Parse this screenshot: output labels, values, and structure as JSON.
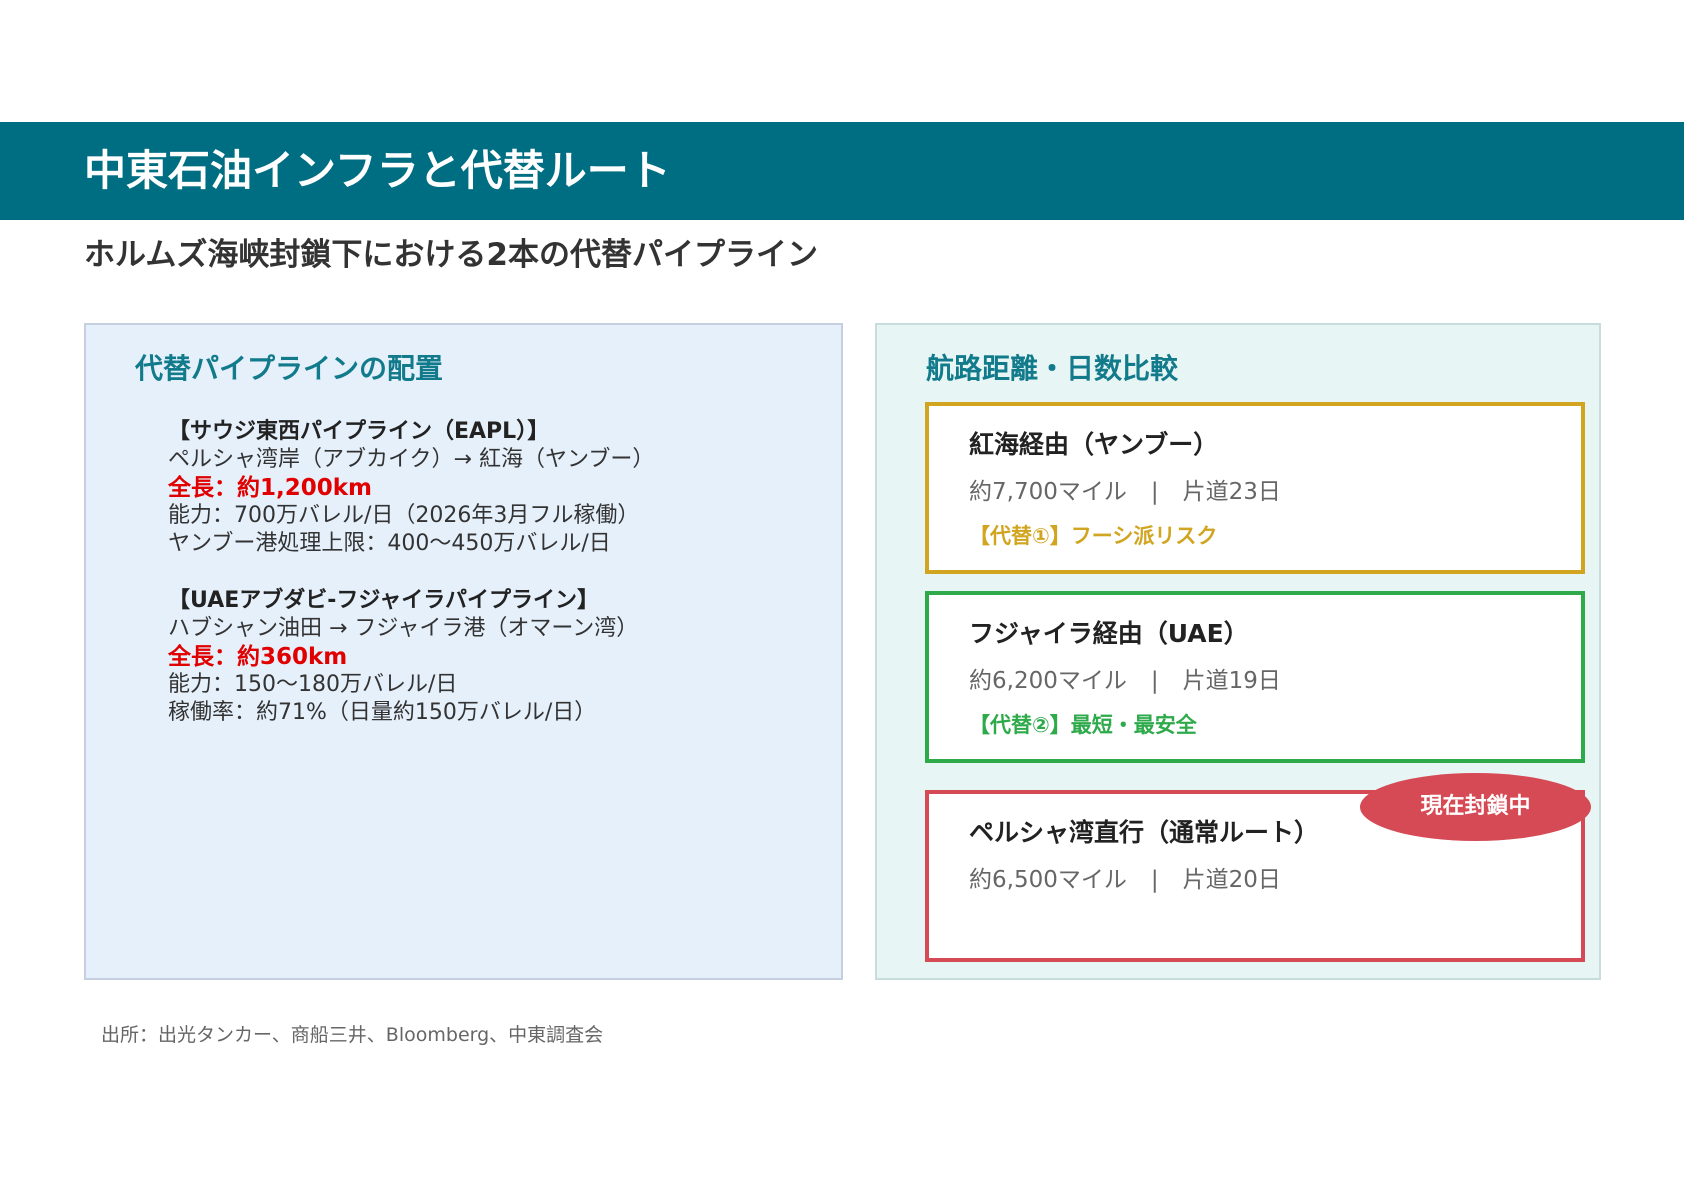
{
  "header": {
    "title": "中東石油インフラと代替ルート",
    "subtitle": "ホルムズ海峡封鎖下における2本の代替パイプライン"
  },
  "left_panel": {
    "heading": "代替パイプラインの配置",
    "pipelines": [
      {
        "name": "【サウジ東西パイプライン（EAPL）】",
        "route": "ペルシャ湾岸（アブカイク）→ 紅海（ヤンブー）",
        "length": "全長：約1,200km",
        "details": [
          "能力：700万バレル/日（2026年3月フル稼働）",
          "ヤンブー港処理上限：400〜450万バレル/日"
        ]
      },
      {
        "name": "【UAEアブダビ-フジャイラパイプライン】",
        "route": "ハブシャン油田 → フジャイラ港（オマーン湾）",
        "length": "全長：約360km",
        "details": [
          "能力：150〜180万バレル/日",
          "稼働率：約71%（日量約150万バレル/日）"
        ]
      }
    ]
  },
  "right_panel": {
    "heading": "航路距離・日数比較",
    "routes": [
      {
        "name": "紅海経由（ヤンブー）",
        "distance": "約7,700マイル",
        "separator": "|",
        "duration": "片道23日",
        "note": "【代替①】フーシ派リスク",
        "color": "#d1a520"
      },
      {
        "name": "フジャイラ経由（UAE）",
        "distance": "約6,200マイル",
        "separator": "|",
        "duration": "片道19日",
        "note": "【代替②】最短・最安全",
        "color": "#2eaa4b"
      },
      {
        "name": "ペルシャ湾直行（通常ルート）",
        "distance": "約6,500マイル",
        "separator": "|",
        "duration": "片道20日",
        "badge": "現在封鎖中",
        "color": "#d64a55"
      }
    ]
  },
  "footer": {
    "source": "出所：出光タンカー、商船三井、Bloomberg、中東調査会"
  },
  "colors": {
    "title_bar": "#006e82",
    "heading": "#117a8b",
    "highlight_red": "#e00000",
    "left_panel_bg": "#e6f0fb",
    "right_panel_bg": "#e8f5f5"
  }
}
